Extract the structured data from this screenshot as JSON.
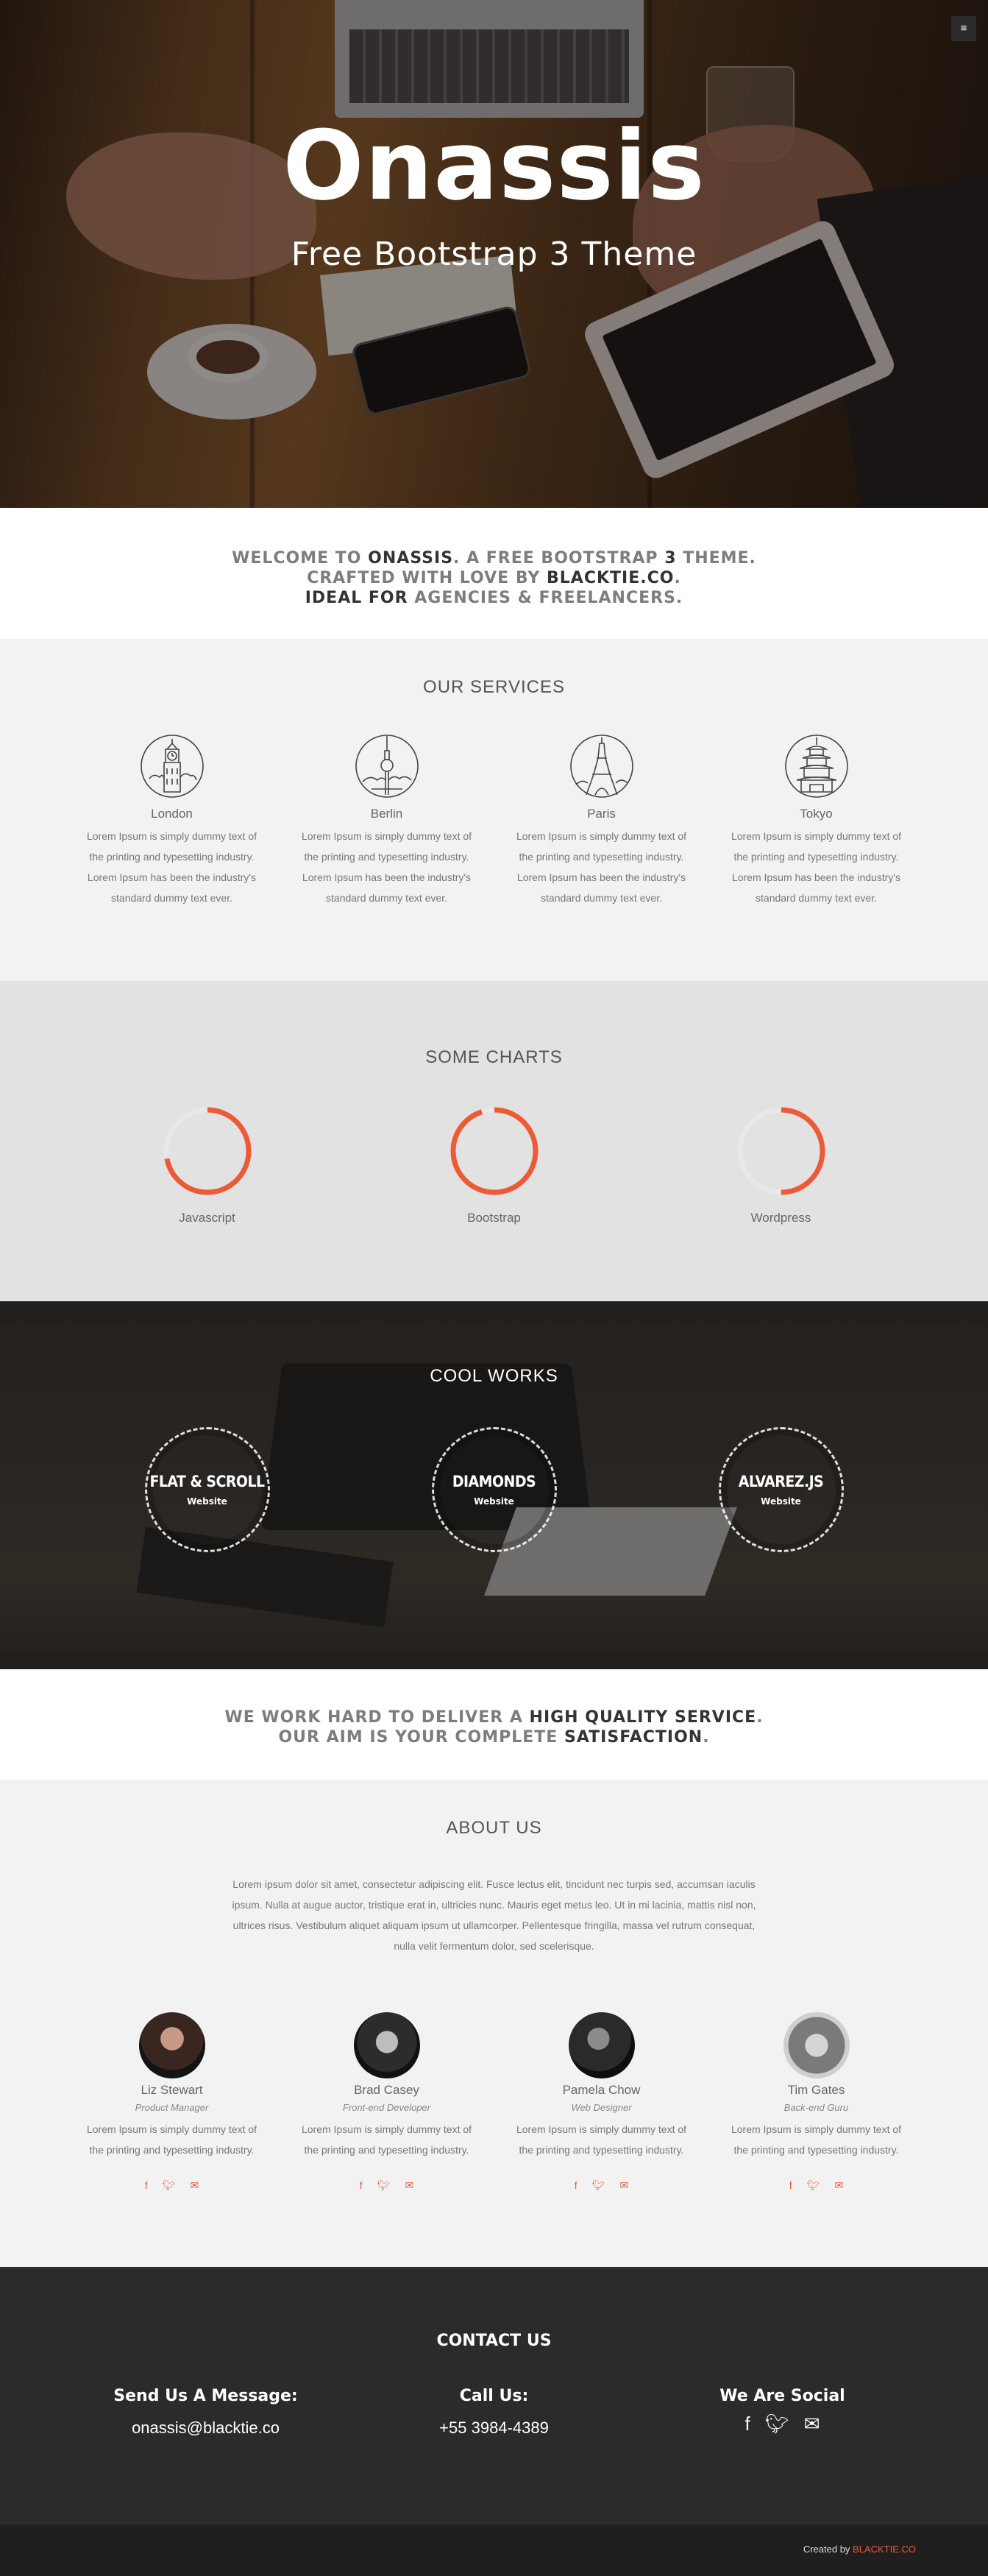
{
  "hero": {
    "title": "Onassis",
    "subtitle": "Free Bootstrap 3 Theme",
    "menu_icon": "hamburger-icon"
  },
  "intro": {
    "line1": [
      "WELCOME TO ",
      "ONASSIS",
      ". A FREE BOOTSTRAP ",
      "3",
      " THEME."
    ],
    "line2": [
      "CRAFTED WITH LOVE BY ",
      "BLACKTIE.CO",
      "."
    ],
    "line3": [
      "IDEAL FOR",
      " AGENCIES & FREELANCERS."
    ]
  },
  "services": {
    "title": "OUR SERVICES",
    "items": [
      {
        "city": "London",
        "icon": "big-ben-icon",
        "desc": "Lorem Ipsum is simply dummy text of the printing and typesetting industry. Lorem Ipsum has been the industry's standard dummy text ever."
      },
      {
        "city": "Berlin",
        "icon": "tv-tower-icon",
        "desc": "Lorem Ipsum is simply dummy text of the printing and typesetting industry. Lorem Ipsum has been the industry's standard dummy text ever."
      },
      {
        "city": "Paris",
        "icon": "eiffel-tower-icon",
        "desc": "Lorem Ipsum is simply dummy text of the printing and typesetting industry. Lorem Ipsum has been the industry's standard dummy text ever."
      },
      {
        "city": "Tokyo",
        "icon": "pagoda-icon",
        "desc": "Lorem Ipsum is simply dummy text of the printing and typesetting industry. Lorem Ipsum has been the industry's standard dummy text ever."
      }
    ]
  },
  "charts": {
    "title": "SOME CHARTS",
    "accent": "#ec5a36",
    "track": "#e8e8e8",
    "items": [
      {
        "label": "Javascript",
        "fraction": 0.72
      },
      {
        "label": "Bootstrap",
        "fraction": 0.95
      },
      {
        "label": "Wordpress",
        "fraction": 0.5
      }
    ]
  },
  "works": {
    "title": "COOL WORKS",
    "items": [
      {
        "name": "FLAT & SCROLL",
        "type": "Website"
      },
      {
        "name": "DIAMONDS",
        "type": "Website"
      },
      {
        "name": "ALVAREZ.JS",
        "type": "Website"
      }
    ]
  },
  "callout": {
    "line1": [
      "WE WORK HARD TO DELIVER A ",
      "HIGH QUALITY SERVICE",
      "."
    ],
    "line2": [
      "OUR AIM IS YOUR COMPLETE ",
      "SATISFACTION",
      "."
    ]
  },
  "about": {
    "title": "ABOUT US",
    "lead": "Lorem ipsum dolor sit amet, consectetur adipiscing elit. Fusce lectus elit, tincidunt nec turpis sed, accumsan iaculis ipsum. Nulla at augue auctor, tristique erat in, ultricies nunc. Mauris eget metus leo. Ut in mi lacinia, mattis nisl non, ultrices risus. Vestibulum aliquet aliquam ipsum ut ullamcorper. Pellentesque fringilla, massa vel rutrum consequat, nulla velit fermentum dolor, sed scelerisque.",
    "team": [
      {
        "name": "Liz Stewart",
        "role": "Product Manager",
        "bio": "Lorem Ipsum is simply dummy text of the printing and typesetting industry."
      },
      {
        "name": "Brad Casey",
        "role": "Front-end Developer",
        "bio": "Lorem Ipsum is simply dummy text of the printing and typesetting industry."
      },
      {
        "name": "Pamela Chow",
        "role": "Web Designer",
        "bio": "Lorem Ipsum is simply dummy text of the printing and typesetting industry."
      },
      {
        "name": "Tim Gates",
        "role": "Back-end Guru",
        "bio": "Lorem Ipsum is simply dummy text of the printing and typesetting industry."
      }
    ],
    "social_icons": [
      "facebook-icon",
      "twitter-icon",
      "envelope-icon"
    ],
    "accent": "#e8593a"
  },
  "contact": {
    "title": "CONTACT US",
    "message_heading": "Send Us A Message:",
    "email": "onassis@blacktie.co",
    "call_heading": "Call Us:",
    "phone": "+55 3984-4389",
    "social_heading": "We Are Social",
    "social_icons": [
      "facebook-icon",
      "twitter-icon",
      "envelope-icon"
    ]
  },
  "footer": {
    "created_by": "Created by ",
    "brand": "BLACKTIE.CO"
  }
}
